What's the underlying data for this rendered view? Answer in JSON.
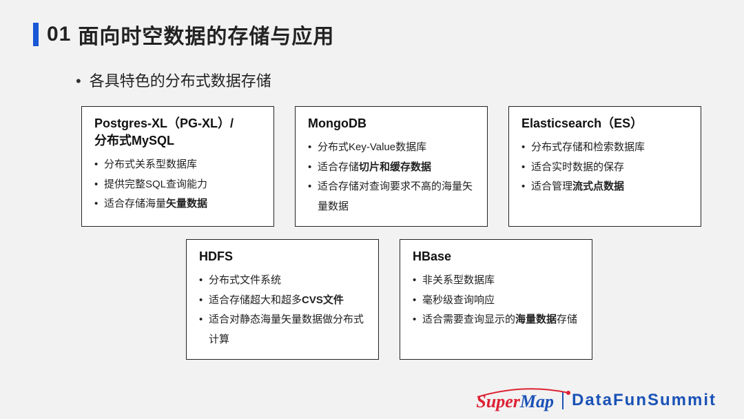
{
  "title_num": "01",
  "title_text": "面向时空数据的存储与应用",
  "subtitle": "各具特色的分布式数据存储",
  "cards_top": [
    {
      "title_line1": "Postgres-XL（PG-XL）/",
      "title_line2": "分布式MySQL",
      "items": [
        {
          "pre": "分布式关系型数据库",
          "bold": "",
          "post": ""
        },
        {
          "pre": "提供完整SQL查询能力",
          "bold": "",
          "post": ""
        },
        {
          "pre": "适合存储海量",
          "bold": "矢量数据",
          "post": ""
        }
      ]
    },
    {
      "title_line1": "MongoDB",
      "title_line2": "",
      "items": [
        {
          "pre": "分布式Key-Value数据库",
          "bold": "",
          "post": ""
        },
        {
          "pre": "适合存储",
          "bold": "切片和缓存数据",
          "post": ""
        },
        {
          "pre": "适合存储对查询要求不高的海量矢量数据",
          "bold": "",
          "post": ""
        }
      ]
    },
    {
      "title_line1": "Elasticsearch（ES）",
      "title_line2": "",
      "items": [
        {
          "pre": "分布式存储和检索数据库",
          "bold": "",
          "post": ""
        },
        {
          "pre": "适合实时数据的保存",
          "bold": "",
          "post": ""
        },
        {
          "pre": "适合管理",
          "bold": "流式点数据",
          "post": ""
        }
      ]
    }
  ],
  "cards_bottom": [
    {
      "title_line1": "HDFS",
      "title_line2": "",
      "items": [
        {
          "pre": "分布式文件系统",
          "bold": "",
          "post": ""
        },
        {
          "pre": "适合存储超大和超多",
          "bold": "CVS文件",
          "post": ""
        },
        {
          "pre": "适合对静态海量矢量数据做分布式计算",
          "bold": "",
          "post": ""
        }
      ]
    },
    {
      "title_line1": "HBase",
      "title_line2": "",
      "items": [
        {
          "pre": "非关系型数据库",
          "bold": "",
          "post": ""
        },
        {
          "pre": "毫秒级查询响应",
          "bold": "",
          "post": ""
        },
        {
          "pre": "适合需要查询显示的",
          "bold": "海量数据",
          "post": "存储"
        }
      ]
    }
  ],
  "footer": {
    "logo_super": "Super",
    "logo_map": "Map",
    "brand": "DataFunSummit"
  }
}
